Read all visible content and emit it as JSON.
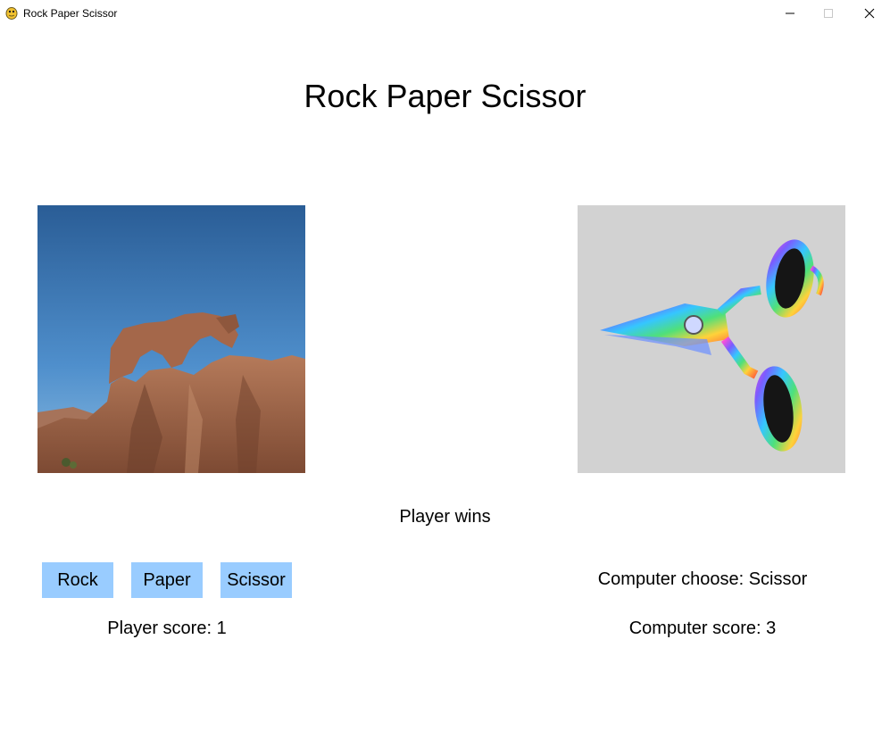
{
  "window": {
    "title": "Rock Paper Scissor",
    "icon": "pygame-snake-icon"
  },
  "heading": "Rock Paper Scissor",
  "player_choice_image": "rock-image",
  "computer_choice_image": "scissors-image",
  "result": "Player wins",
  "buttons": {
    "rock": "Rock",
    "paper": "Paper",
    "scissor": "Scissor"
  },
  "computer_choice_text": "Computer choose: Scissor",
  "player_score_text": "Player score: 1",
  "computer_score_text": "Computer score: 3",
  "colors": {
    "button_bg": "#99ccff",
    "background": "#ffffff"
  }
}
